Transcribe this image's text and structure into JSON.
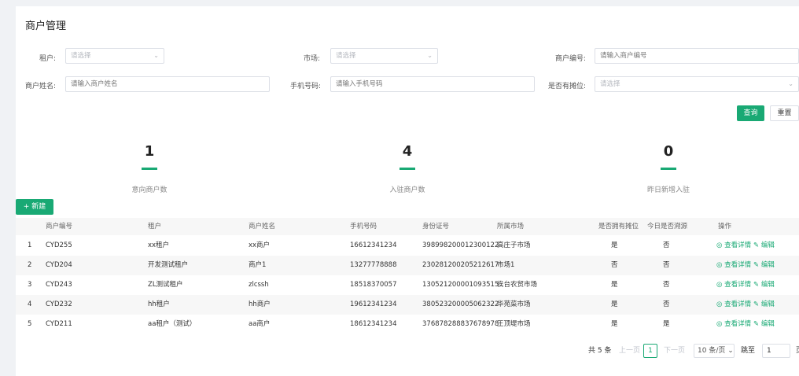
{
  "page": {
    "title": "商户管理"
  },
  "filters": {
    "tenant": {
      "label": "租户:",
      "placeholder": "请选择"
    },
    "market": {
      "label": "市场:",
      "placeholder": "请选择"
    },
    "merchant_no": {
      "label": "商户编号:",
      "placeholder": "请输入商户编号"
    },
    "merchant_name": {
      "label": "商户姓名:",
      "placeholder": "请输入商户姓名"
    },
    "phone": {
      "label": "手机号码:",
      "placeholder": "请输入手机号码"
    },
    "has_stall": {
      "label": "是否有摊位:",
      "placeholder": "请选择"
    }
  },
  "buttons": {
    "query": "查询",
    "reset": "重置",
    "new": "+ 新建"
  },
  "stats": [
    {
      "value": "1",
      "label": "意向商户数"
    },
    {
      "value": "4",
      "label": "入驻商户数"
    },
    {
      "value": "0",
      "label": "昨日新增入驻"
    }
  ],
  "table": {
    "headers": [
      "商户编号",
      "租户",
      "商户姓名",
      "手机号码",
      "身份证号",
      "所属市场",
      "是否拥有摊位",
      "今日是否溯源",
      "操作"
    ],
    "rows": [
      {
        "idx": "1",
        "no": "CYD255",
        "tenant": "xx租户",
        "name": "xx商户",
        "phone": "16612341234",
        "id": "398998200012300122",
        "market": "高庄子市场",
        "stall": "是",
        "trace": "否"
      },
      {
        "idx": "2",
        "no": "CYD204",
        "tenant": "开发测试租户",
        "name": "商户1",
        "phone": "13277778888",
        "id": "230281200205212617",
        "market": "市场1",
        "stall": "否",
        "trace": "否"
      },
      {
        "idx": "3",
        "no": "CYD243",
        "tenant": "ZL测试租户",
        "name": "zlcssh",
        "phone": "18518370057",
        "id": "130521200001093515",
        "market": "俟台农贸市场",
        "stall": "是",
        "trace": "否"
      },
      {
        "idx": "4",
        "no": "CYD232",
        "tenant": "hh租户",
        "name": "hh商户",
        "phone": "19612341234",
        "id": "380523200005062322",
        "market": "华苑菜市场",
        "stall": "是",
        "trace": "否"
      },
      {
        "idx": "5",
        "no": "CYD211",
        "tenant": "aa租户（测试）",
        "name": "aa商户",
        "phone": "18612341234",
        "id": "376878288837678978",
        "market": "王顶堤市场",
        "stall": "是",
        "trace": "是"
      }
    ],
    "actions": {
      "view": "查看详情",
      "edit": "编辑"
    }
  },
  "pagination": {
    "total": "共 5 条",
    "prev": "上一页",
    "current": "1",
    "next": "下一页",
    "page_size": "10 条/页",
    "jump_label": "跳至",
    "jump_value": "1",
    "page_suffix": "页"
  },
  "colors": {
    "primary": "#19a974",
    "background": "#f0f2f5"
  },
  "icons": {
    "eye": "eye-icon",
    "edit": "edit-icon",
    "chevron": "chevron-down-icon"
  }
}
